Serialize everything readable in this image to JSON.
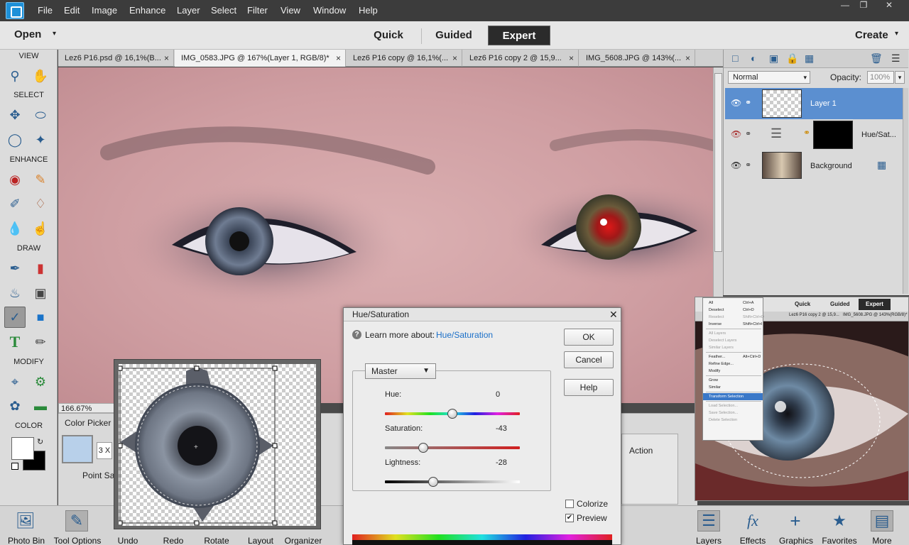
{
  "menubar": {
    "items": [
      "File",
      "Edit",
      "Image",
      "Enhance",
      "Layer",
      "Select",
      "Filter",
      "View",
      "Window",
      "Help"
    ]
  },
  "modebar": {
    "open_label": "Open",
    "tabs": [
      "Quick",
      "Guided",
      "Expert"
    ],
    "active_tab": "Expert",
    "create_label": "Create"
  },
  "toolbox": {
    "sections": [
      "VIEW",
      "SELECT",
      "ENHANCE",
      "DRAW",
      "MODIFY",
      "COLOR"
    ]
  },
  "doc_tabs": [
    "Lez6 P16.psd @ 16,1%(B...",
    "IMG_0583.JPG @ 167%(Layer 1, RGB/8)*",
    "Lez6 P16 copy @ 16,1%(...",
    "Lez6 P16 copy 2 @ 15,9...",
    "IMG_5608.JPG @ 143%(..."
  ],
  "status": {
    "zoom": "166.67%"
  },
  "tool_options": {
    "title": "Color Picker",
    "sample_size": "3 X",
    "point_label": "Point Sa"
  },
  "bottombar": {
    "items": [
      "Photo Bin",
      "Tool Options",
      "Undo",
      "Redo",
      "Rotate",
      "Layout",
      "Organizer"
    ]
  },
  "right_bottom": {
    "items": [
      "Layers",
      "Effects",
      "Graphics",
      "Favorites",
      "More"
    ]
  },
  "layers_panel": {
    "blend_mode": "Normal",
    "opacity_label": "Opacity:",
    "opacity_value": "100%",
    "layers": [
      {
        "name": "Layer 1",
        "selected": true,
        "visible": true
      },
      {
        "name": "Hue/Sat...",
        "selected": false,
        "visible": false
      },
      {
        "name": "Background",
        "selected": false,
        "visible": true
      }
    ]
  },
  "huesat_dialog": {
    "title": "Hue/Saturation",
    "learn_prefix": "Learn more about:",
    "learn_link": "Hue/Saturation",
    "channel": "Master",
    "hue_label": "Hue:",
    "hue_value": "0",
    "saturation_label": "Saturation:",
    "saturation_value": "-43",
    "lightness_label": "Lightness:",
    "lightness_value": "-28",
    "ok": "OK",
    "cancel": "Cancel",
    "help": "Help",
    "colorize": "Colorize",
    "preview": "Preview",
    "colorize_checked": false,
    "preview_checked": true,
    "hue_position": 0.5,
    "saturation_position": 0.285,
    "lightness_position": 0.36
  },
  "panel_action": {
    "label": "Action"
  },
  "reference": {
    "tabs": [
      "Quick",
      "Guided",
      "Expert"
    ],
    "menu_items": [
      "All",
      "Deselect",
      "Reselect",
      "Inverse",
      "All Layers",
      "Deselect Layers",
      "Similar Layers",
      "Feather...",
      "Refine Edge...",
      "Modify",
      "Grow",
      "Similar",
      "Transform Selection",
      "Load Selection...",
      "Save Selection...",
      "Delete Selection"
    ],
    "shortcuts": [
      "Ctrl+A",
      "Ctrl+D",
      "Shift+Ctrl+D",
      "Shift+Ctrl+I",
      "",
      "",
      "",
      "Alt+Ctrl+D",
      "",
      "",
      "",
      "",
      "",
      "",
      "",
      ""
    ],
    "doc_tabs": [
      "Lez6 P16 copy 2 @ 15,9...",
      "IMG_5608.JPG @ 143%(RGB/8)*"
    ]
  },
  "colors": {
    "selected_layer": "#5b8fd0",
    "link_blue": "#1a6fc8"
  }
}
